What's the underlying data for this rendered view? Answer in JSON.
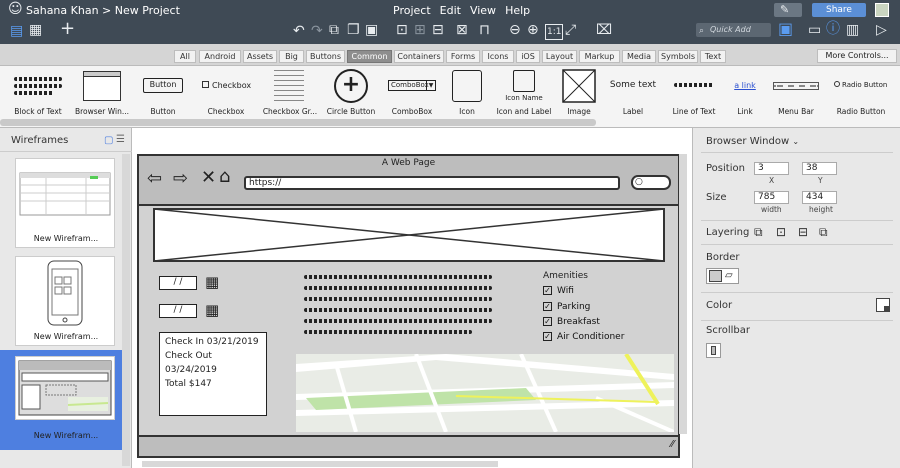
{
  "topbar": {
    "breadcrumb": "Sahana Khan > New Project",
    "menu": [
      "Project",
      "Edit",
      "View",
      "Help"
    ],
    "quick_add": "Quick Add",
    "share": "Share"
  },
  "tabs": [
    "All",
    "Android",
    "Assets",
    "Big",
    "Buttons",
    "Common",
    "Containers",
    "Forms",
    "Icons",
    "iOS",
    "Layout",
    "Markup",
    "Media",
    "Symbols",
    "Text"
  ],
  "selected_tab": "Common",
  "more_controls": "More Controls...",
  "library": {
    "items": [
      {
        "label": "Block of Text"
      },
      {
        "label": "Browser Win..."
      },
      {
        "label": "Button",
        "preview": "Button"
      },
      {
        "label": "Checkbox",
        "preview": "Checkbox"
      },
      {
        "label": "Checkbox Gr..."
      },
      {
        "label": "Circle Button",
        "preview": "+"
      },
      {
        "label": "ComboBox",
        "preview": "ComboBox"
      },
      {
        "label": "Icon"
      },
      {
        "label": "Icon and Label",
        "preview": "Icon Name"
      },
      {
        "label": "Image"
      },
      {
        "label": "Label",
        "preview": "Some text"
      },
      {
        "label": "Line of Text"
      },
      {
        "label": "Link",
        "preview": "a link"
      },
      {
        "label": "Menu Bar"
      },
      {
        "label": "Radio Button",
        "preview": "Radio Button"
      }
    ]
  },
  "left_panel": {
    "title": "Wireframes",
    "thumbs": [
      "New Wirefram...",
      "New Wirefram...",
      "New Wirefram..."
    ]
  },
  "mock": {
    "title": "A Web Page",
    "url": "https://",
    "dates": [
      "/  /",
      "/  /"
    ],
    "booking": [
      "Check In 03/21/2019",
      "Check Out 03/24/2019",
      "Total $147"
    ],
    "amenities_title": "Amenities",
    "amenities": [
      "Wifi",
      "Parking",
      "Breakfast",
      "Air Conditioner"
    ]
  },
  "right_panel": {
    "title": "Browser Window",
    "position_label": "Position",
    "x": "3",
    "y": "38",
    "x_lbl": "X",
    "y_lbl": "Y",
    "size_label": "Size",
    "w": "785",
    "h": "434",
    "w_lbl": "width",
    "h_lbl": "height",
    "layering": "Layering",
    "border": "Border",
    "color": "Color",
    "scrollbar": "Scrollbar"
  }
}
